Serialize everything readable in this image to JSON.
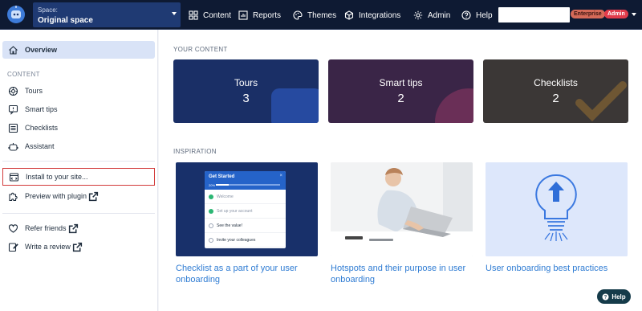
{
  "colors": {
    "topbar": "#0e1a33",
    "space_selector": "#1f3a73",
    "accent_link": "#2f7cd3",
    "tours_card": "#1a2f66",
    "tips_card": "#3a2547",
    "checklists_card": "#3b3736",
    "enterprise_badge": "#d56a58",
    "admin_badge": "#e23b4b",
    "highlight_outline": "#d23a3a"
  },
  "topbar": {
    "space_label": "Space:",
    "space_value": "Original space",
    "nav": [
      {
        "label": "Content",
        "icon": "grid-icon"
      },
      {
        "label": "Reports",
        "icon": "reports-icon"
      },
      {
        "label": "Themes",
        "icon": "palette-icon"
      },
      {
        "label": "Integrations",
        "icon": "cube-icon"
      },
      {
        "label": "Admin",
        "icon": "gear-icon"
      },
      {
        "label": "Help",
        "icon": "help-icon"
      }
    ],
    "search_value": "",
    "badges": {
      "enterprise": "Enterprise",
      "admin": "Admin"
    }
  },
  "sidebar": {
    "overview": "Overview",
    "content_heading": "CONTENT",
    "items": [
      {
        "label": "Tours",
        "icon": "tours-icon"
      },
      {
        "label": "Smart tips",
        "icon": "smart-tip-icon"
      },
      {
        "label": "Checklists",
        "icon": "checklist-icon"
      },
      {
        "label": "Assistant",
        "icon": "assistant-icon"
      }
    ],
    "install": "Install to your site...",
    "preview": "Preview with plugin",
    "refer": "Refer friends",
    "review": "Write a review"
  },
  "main": {
    "your_content_heading": "YOUR CONTENT",
    "cards": [
      {
        "label": "Tours",
        "count": "3"
      },
      {
        "label": "Smart tips",
        "count": "2"
      },
      {
        "label": "Checklists",
        "count": "2"
      }
    ],
    "inspiration_heading": "INSPIRATION",
    "checklist_mock": {
      "title": "Get Started",
      "progress_text": "20%",
      "progress": 0.2,
      "items": [
        "Welcome",
        "Set up your account",
        "See the value!",
        "Invite your colleagues"
      ],
      "completed": [
        true,
        true,
        false,
        false
      ]
    },
    "inspiration": [
      {
        "title": "Checklist as a part of your user onboarding"
      },
      {
        "title": "Hotspots and their purpose in user onboarding"
      },
      {
        "title": "User onboarding best practices"
      }
    ]
  },
  "help_button": "Help"
}
